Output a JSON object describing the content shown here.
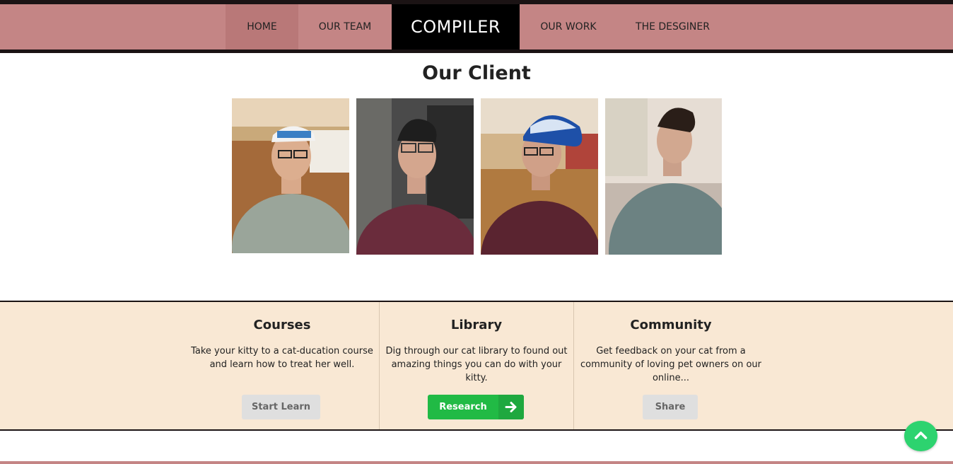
{
  "nav": {
    "items": [
      {
        "label": "HOME"
      },
      {
        "label": "OUR TEAM"
      },
      {
        "label": "OUR WORK"
      },
      {
        "label": "THE DESGINER"
      }
    ],
    "brand": "COMPILER"
  },
  "client": {
    "title": "Our Client"
  },
  "features": [
    {
      "title": "Courses",
      "text": "Take your kitty to a cat-ducation course and learn how to treat her well.",
      "button": "Start Learn"
    },
    {
      "title": "Library",
      "text": "Dig through our cat library to found out amazing things you can do with your kitty.",
      "button": "Research"
    },
    {
      "title": "Community",
      "text": "Get feedback on your cat from a community of loving pet owners on our online...",
      "button": "Share"
    }
  ],
  "colors": {
    "nav_bg": "#c48585",
    "brand_bg": "#000000",
    "band_bg": "#f9e8d4",
    "research_button": "#21ba45",
    "scroll_top": "#2dd36f"
  }
}
